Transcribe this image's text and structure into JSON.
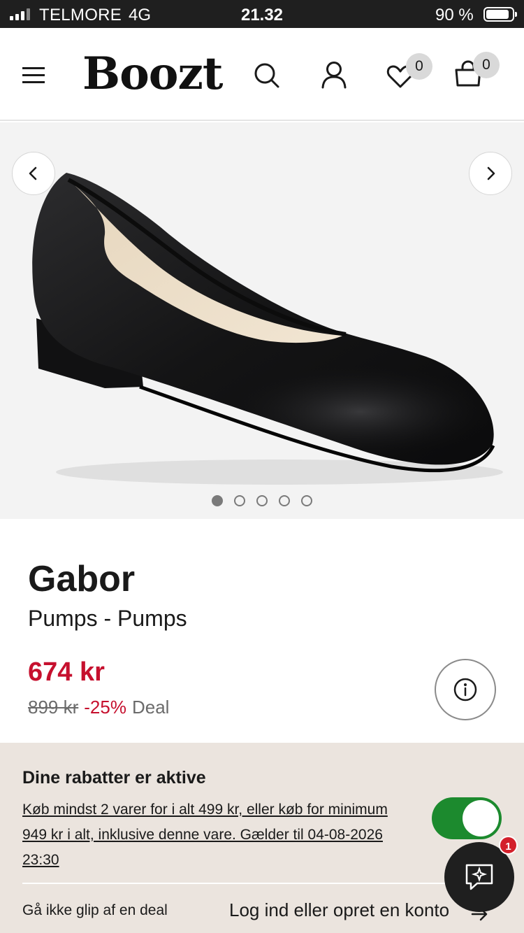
{
  "status_bar": {
    "carrier": "TELMORE",
    "network": "4G",
    "time": "21.32",
    "battery": "90 %",
    "battery_level": 0.9
  },
  "header": {
    "logo": "Boozt",
    "wishlist_count": "0",
    "cart_count": "0",
    "icons": [
      "menu-icon",
      "search-icon",
      "account-icon",
      "heart-icon",
      "bag-icon"
    ]
  },
  "gallery": {
    "image_count": 5,
    "active_index": 0
  },
  "product": {
    "brand": "Gabor",
    "subtitle": "Pumps - Pumps",
    "price": "674 kr",
    "old_price": "899 kr",
    "discount": "-25%",
    "deal_label": "Deal"
  },
  "discounts": {
    "title": "Dine rabatter er aktive",
    "text": "Køb mindst 2 varer for i alt 499 kr, eller køb for minimum 949 kr i alt, inklusive denne vare. Gælder til 04-08-2026 23:30",
    "toggle_on": true,
    "bottom_left": "Gå ikke glip af en deal",
    "login_link": "Log ind eller opret en konto"
  },
  "chat": {
    "badge": "1"
  },
  "colors": {
    "accent_red": "#c6102e",
    "toggle_green": "#1c8a2e",
    "panel_bg": "#ebe4de"
  }
}
